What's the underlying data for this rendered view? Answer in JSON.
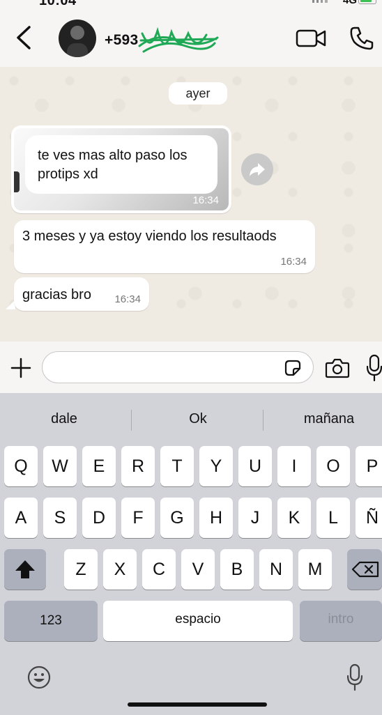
{
  "status_bar": {
    "time": "10:04",
    "network": "4G"
  },
  "header": {
    "contact": "+593"
  },
  "chat": {
    "date_separator": "ayer",
    "messages": [
      {
        "type": "image",
        "text": "te ves mas alto paso los protips xd",
        "time": "16:34"
      },
      {
        "type": "text",
        "text": "3 meses y ya estoy viendo los resultaods",
        "time": "16:34"
      },
      {
        "type": "text",
        "text": "gracias bro",
        "time": "16:34"
      }
    ]
  },
  "input": {
    "value": "",
    "placeholder": ""
  },
  "keyboard": {
    "suggestions": [
      "dale",
      "Ok",
      "mañana"
    ],
    "row1": [
      "Q",
      "W",
      "E",
      "R",
      "T",
      "Y",
      "U",
      "I",
      "O",
      "P"
    ],
    "row2": [
      "A",
      "S",
      "D",
      "F",
      "G",
      "H",
      "J",
      "K",
      "L",
      "Ñ"
    ],
    "row3": [
      "Z",
      "X",
      "C",
      "V",
      "B",
      "N",
      "M"
    ],
    "numbers_key": "123",
    "space_key": "espacio",
    "return_key": "intro"
  },
  "icons": {
    "back": "chevron-left-icon",
    "video": "video-camera-icon",
    "call": "phone-icon",
    "forward": "forward-icon",
    "plus": "plus-icon",
    "sticker": "sticker-icon",
    "camera": "camera-icon",
    "mic": "microphone-icon",
    "shift": "shift-icon",
    "delete": "backspace-icon",
    "emoji": "emoji-icon"
  },
  "colors": {
    "accent_green": "#1fa855",
    "chat_bg": "#efeae2",
    "keyboard_bg": "#d1d3d9"
  }
}
